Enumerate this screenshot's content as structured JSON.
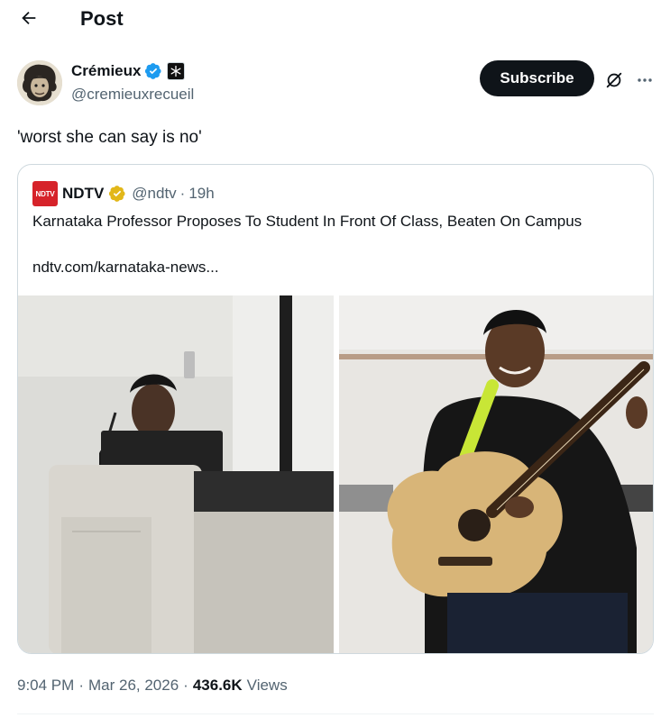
{
  "header": {
    "title": "Post",
    "back_icon": "arrow-left-icon"
  },
  "author": {
    "name": "Crémieux",
    "handle": "@cremieuxrecueil",
    "verified_color": "#1d9bf0",
    "affiliate_badge_icon": "snowflake-badge-icon"
  },
  "actions": {
    "subscribe_label": "Subscribe",
    "grok_icon": "grok-icon",
    "more_icon": "more-dots-icon"
  },
  "tweet": {
    "text": "'worst she can say is no'"
  },
  "quote": {
    "logo_text": "NDTV",
    "name": "NDTV",
    "verified_color": "#e2b719",
    "handle": "@ndtv",
    "separator": "·",
    "time": "19h",
    "headline": "Karnataka Professor Proposes To Student In Front Of Class, Beaten On Campus",
    "link": "ndtv.com/karnataka-news..."
  },
  "footer": {
    "time": "9:04 PM",
    "dot1": "·",
    "date": "Mar 26, 2026",
    "dot2": "·",
    "views_count": "436.6K",
    "views_label": "Views"
  },
  "colors": {
    "text_primary": "#0f1419",
    "text_secondary": "#536471",
    "border": "#cfd9de",
    "ndtv_red": "#d6232a"
  }
}
